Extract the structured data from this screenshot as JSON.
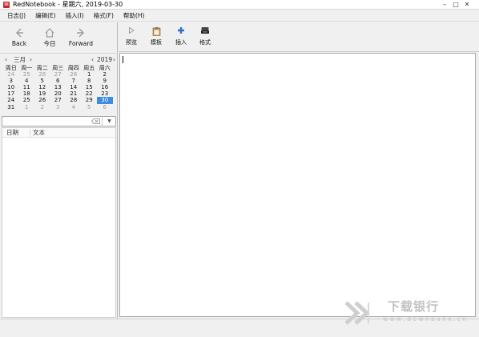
{
  "window": {
    "title": "RedNotebook - 星期六, 2019-03-30",
    "controls": {
      "minimize": "–",
      "maximize": "□",
      "close": "✕"
    },
    "app_icon": "rednotebook-app-icon"
  },
  "menu": [
    "日志(J)",
    "编辑(E)",
    "插入(I)",
    "格式(F)",
    "帮助(H)"
  ],
  "nav": {
    "back": {
      "label": "Back",
      "icon": "arrow-left-icon"
    },
    "today": {
      "label": "今日",
      "icon": "home-icon"
    },
    "forward": {
      "label": "Forward",
      "icon": "arrow-right-icon"
    }
  },
  "calendar": {
    "month": "三月",
    "year": "2019",
    "prev_month": "‹",
    "next_month": "›",
    "prev_year": "‹",
    "next_year": "›",
    "weekdays": [
      "周日",
      "周一",
      "周二",
      "周三",
      "周四",
      "周五",
      "周六"
    ],
    "weeks": [
      [
        "24",
        "25",
        "26",
        "27",
        "28",
        "1",
        "2"
      ],
      [
        "3",
        "4",
        "5",
        "6",
        "7",
        "8",
        "9"
      ],
      [
        "10",
        "11",
        "12",
        "13",
        "14",
        "15",
        "16"
      ],
      [
        "17",
        "18",
        "19",
        "20",
        "21",
        "22",
        "23"
      ],
      [
        "24",
        "25",
        "26",
        "27",
        "28",
        "29",
        "30"
      ],
      [
        "31",
        "1",
        "2",
        "3",
        "4",
        "5",
        "6"
      ]
    ],
    "selected": "30",
    "accent": "#3c8de0"
  },
  "search": {
    "value": "",
    "placeholder": "",
    "clear_icon": "clear-icon",
    "dropdown_icon": "dropdown-icon"
  },
  "list": {
    "columns": [
      "日期",
      "文本"
    ]
  },
  "toolbar": {
    "buttons": [
      {
        "label": "预览",
        "icon": "play-icon",
        "color": "#9a9a9a"
      },
      {
        "label": "模板",
        "icon": "clipboard-icon",
        "color": "#b07a2a"
      },
      {
        "label": "插入",
        "icon": "plus-icon",
        "color": "#2f6fc0"
      },
      {
        "label": "格式",
        "icon": "format-icon",
        "color": "#333333"
      }
    ]
  },
  "editor": {
    "content": ""
  },
  "watermark": {
    "text_cn": "下载银行",
    "url": "w w w . d o w n b a n k . c n"
  }
}
